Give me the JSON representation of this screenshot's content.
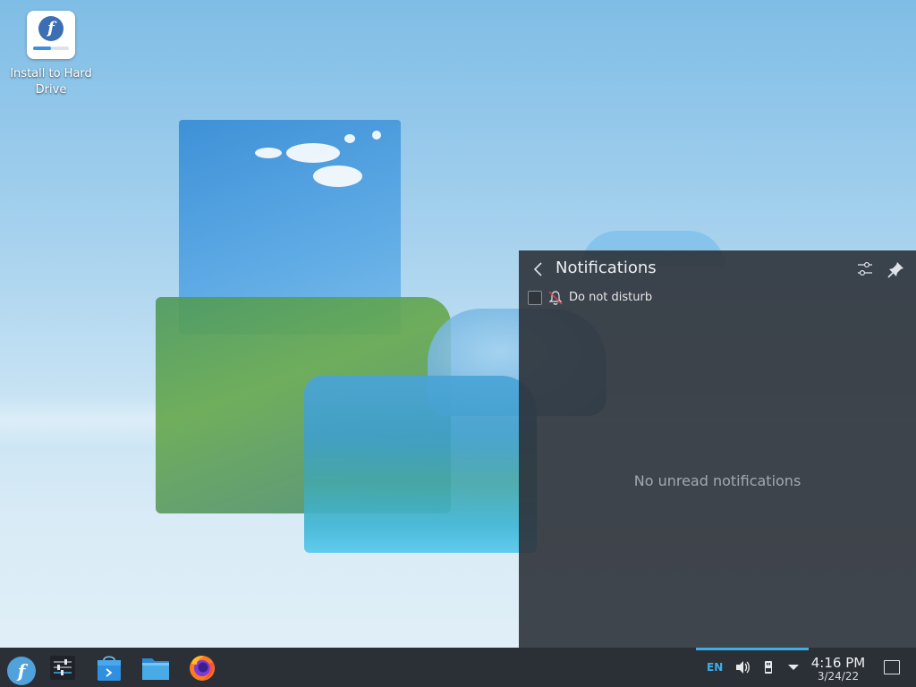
{
  "desktop": {
    "icons": [
      {
        "label": "Install to Hard Drive",
        "icon": "fedora-installer-icon",
        "progress": 0.5
      }
    ]
  },
  "notifications": {
    "title": "Notifications",
    "back_icon": "chevron-left-icon",
    "settings_icon": "configure-sliders-icon",
    "pin_icon": "pin-icon",
    "dnd_label": "Do not disturb",
    "dnd_checked": false,
    "dnd_icon": "bell-disabled-icon",
    "empty_message": "No unread notifications"
  },
  "taskbar": {
    "launchers": [
      {
        "name": "application-launcher",
        "icon": "fedora-logo-icon"
      },
      {
        "name": "system-settings",
        "icon": "settings-sliders-icon"
      },
      {
        "name": "discover",
        "icon": "discover-store-icon"
      },
      {
        "name": "dolphin",
        "icon": "folder-icon"
      },
      {
        "name": "firefox",
        "icon": "firefox-icon"
      }
    ],
    "tray": {
      "language": "EN",
      "volume_icon": "speaker-icon",
      "storage_icon": "usb-drive-icon",
      "expand_icon": "triangle-down-icon"
    },
    "clock": {
      "time": "4:16 PM",
      "date": "3/24/22"
    },
    "show_desktop_icon": "show-desktop-icon"
  },
  "colors": {
    "accent": "#3daee9",
    "panel_bg": "#2b3036",
    "notif_bg": "#2d3239"
  }
}
